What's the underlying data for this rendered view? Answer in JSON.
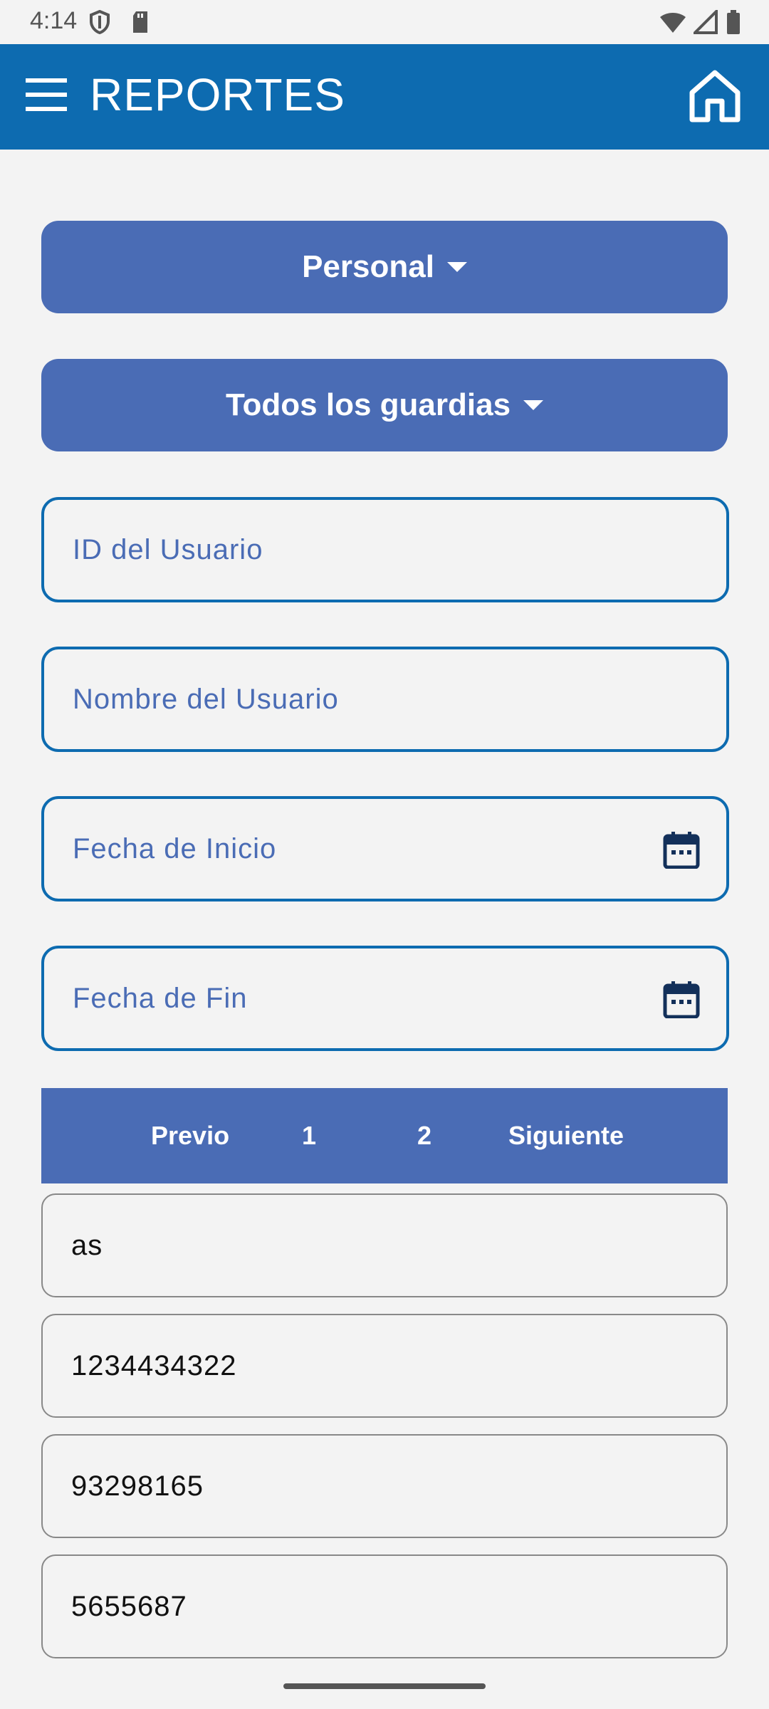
{
  "status_bar": {
    "time": "4:14",
    "icons": [
      "shield-icon",
      "sd-card-icon",
      "wifi-icon",
      "signal-icon",
      "battery-icon"
    ]
  },
  "app_bar": {
    "title": "REPORTES",
    "background": "#0d6bb0"
  },
  "filters": {
    "type_dropdown": "Personal",
    "guard_dropdown": "Todos los guardias"
  },
  "inputs": {
    "user_id_placeholder": "ID del Usuario",
    "user_name_placeholder": "Nombre del Usuario",
    "start_date_placeholder": "Fecha de Inicio",
    "end_date_placeholder": "Fecha de Fin"
  },
  "pagination": {
    "prev": "Previo",
    "page1": "1",
    "page2": "2",
    "next": "Siguiente"
  },
  "results": [
    "as",
    "1234434322",
    "93298165",
    "5655687"
  ],
  "colors": {
    "primary": "#0d6bb0",
    "accent": "#4a6cb5",
    "background": "#f3f3f3"
  }
}
